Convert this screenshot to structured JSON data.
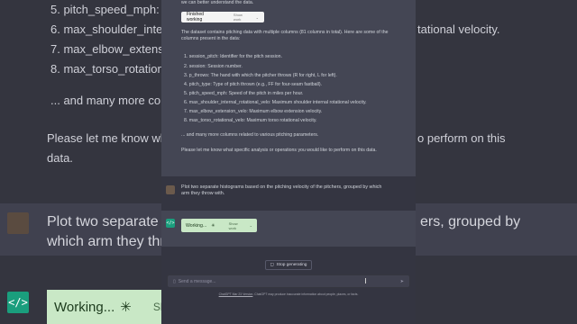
{
  "bg": {
    "lines_top": [
      "5.  pitch_speed_mph: S",
      "6.  max_shoulder_inter",
      "7.  max_elbow_extensio",
      "8.  max_torso_rotation"
    ],
    "right_top": [
      "tational velocity."
    ],
    "more_cols": "... and many more colu",
    "please_left": "Please let me know wh",
    "please_left2": "data.",
    "please_right": "o perform on this",
    "plot_left": "Plot two separate histo",
    "plot_left2": "which arm they throw",
    "plot_right": "ers, grouped by",
    "working": "Working...",
    "show": "Sho"
  },
  "panel": {
    "intro_tail": "we can better understand the data.",
    "finished_pill": {
      "label": "Finished working",
      "show": "Show work"
    },
    "dataset_text": "The dataset contains pitching data with multiple columns (81 columns in total). Here are some of the columns present in the data:",
    "columns": [
      "1.  session_pitch: Identifier for the pitch session.",
      "2.  session: Session number.",
      "3.  p_throws: The hand with which the pitcher throws (R for right, L for left).",
      "4.  pitch_type: Type of pitch thrown (e.g., FF for four-seam fastball).",
      "5.  pitch_speed_mph: Speed of the pitch in miles per hour.",
      "6.  max_shoulder_internal_rotational_velo: Maximum shoulder internal rotational velocity.",
      "7.  max_elbow_extension_velo: Maximum elbow extension velocity.",
      "8.  max_torso_rotational_velo: Maximum torso rotational velocity."
    ],
    "more_text": "... and many more columns related to various pitching parameters.",
    "please_text": "Please let me know what specific analysis or operations you would like to perform on this data.",
    "user_message": "Plot two separate histograms based on the pitching velocity of the pitchers, grouped by which arm they throw with.",
    "working_pill": {
      "label": "Working...",
      "show": "Show work"
    },
    "stop_label": "Stop generating",
    "input_placeholder": "Send a message...",
    "footer_link": "ChatGPT Mar 23 Version",
    "footer_text": ". ChatGPT may produce inaccurate information about people, places, or facts."
  }
}
